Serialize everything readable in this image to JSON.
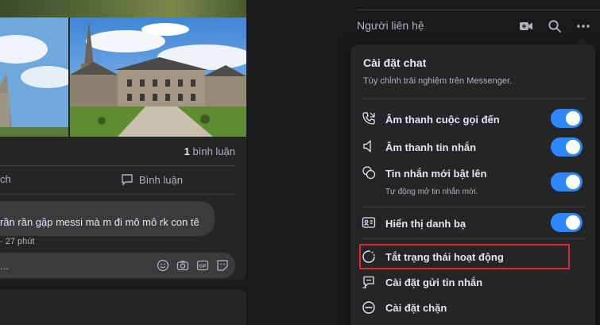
{
  "feed": {
    "comment_count_num": "1",
    "comment_count_label": "bình luận",
    "action_like_partial": "ch",
    "action_comment": "Bình luận",
    "comment_text": "rần rần gặp messi mà m đi mô mô rk con tê",
    "comment_meta": "· 27 phút",
    "reply_placeholder": "..."
  },
  "contacts": {
    "title": "Người liên hệ",
    "icons": [
      "new-room-icon",
      "search-icon",
      "more-icon"
    ]
  },
  "chat_settings": {
    "title": "Cài đặt chat",
    "subtitle": "Tùy chỉnh trải nghiệm trên Messenger.",
    "items": [
      {
        "label": "Âm thanh cuộc gọi đến",
        "icon": "phone-ring-icon",
        "toggle": true
      },
      {
        "label": "Âm thanh tin nhắn",
        "icon": "speaker-icon",
        "toggle": true
      },
      {
        "label": "Tin nhắn mới bật lên",
        "desc": "Tự động mở tin nhắn mới.",
        "icon": "chat-bubbles-icon",
        "toggle": true
      },
      {
        "label": "Hiển thị danh bạ",
        "icon": "contact-card-icon",
        "toggle": true
      },
      {
        "label": "Tắt trạng thái hoạt động",
        "icon": "active-status-icon",
        "toggle": false
      },
      {
        "label": "Cài đặt gửi tin nhắn",
        "icon": "message-delivery-icon",
        "toggle": false
      },
      {
        "label": "Cài đặt chặn",
        "icon": "block-icon",
        "toggle": false
      }
    ],
    "toggle_color": "#2d88ff",
    "highlight_color": "#e0242b"
  }
}
